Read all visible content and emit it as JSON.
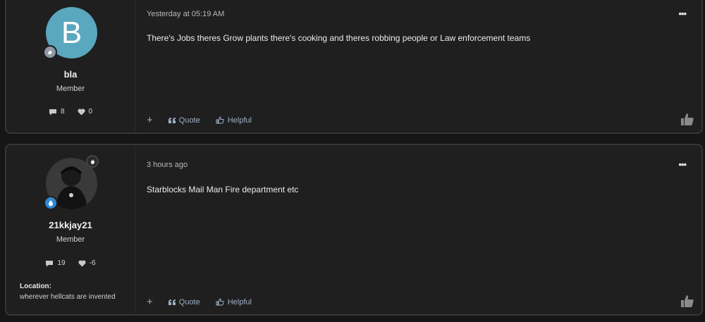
{
  "posts": [
    {
      "user": {
        "avatar_letter": "B",
        "username": "bla",
        "title": "Member",
        "messages": "8",
        "reactions": "0"
      },
      "date": "Yesterday at 05:19 AM",
      "body": "There's Jobs theres Grow plants there's cooking and theres robbing people or Law enforcement teams",
      "actions": {
        "add": "+",
        "quote": "Quote",
        "helpful": "Helpful"
      },
      "more": "•••"
    },
    {
      "user": {
        "username": "21kkjay21",
        "title": "Member",
        "messages": "19",
        "reactions": "-6",
        "location_label": "Location:",
        "location_value": "wherever hellcats are invented"
      },
      "date": "3 hours ago",
      "body": "Starblocks Mail Man Fire department etc",
      "actions": {
        "add": "+",
        "quote": "Quote",
        "helpful": "Helpful"
      },
      "more": "•••"
    }
  ],
  "colors": {
    "page_bg": "#161616",
    "card_bg": "#1f1f1f",
    "card_border": "#363636",
    "avatar_bg": "#5aa7c0",
    "action_text": "#9fb0c4",
    "badge_blue": "#2f8ad8",
    "badge_grey": "#8f98a3"
  },
  "icons": {
    "user_badge_1": "shield-hand-icon",
    "user_badge_2": "shield-drop-icon",
    "online_badge": "hand-icon",
    "messages": "speech-bubble-icon",
    "reactions": "heart-icon",
    "quote": "quote-icon",
    "helpful": "thumbs-up-icon",
    "like": "thumbs-up-icon",
    "more": "ellipsis-icon"
  }
}
